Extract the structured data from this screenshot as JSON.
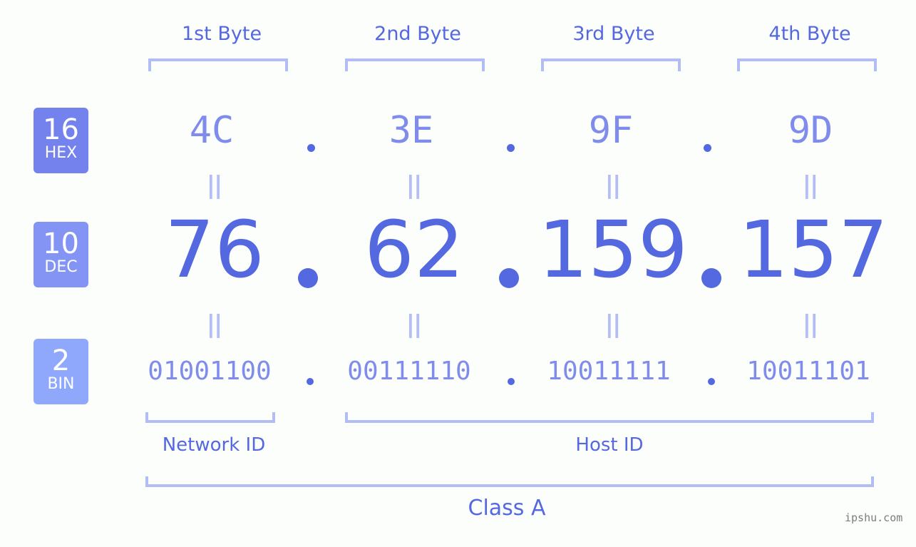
{
  "bytes": [
    {
      "label": "1st Byte",
      "hex": "4C",
      "dec": "76",
      "bin": "01001100"
    },
    {
      "label": "2nd Byte",
      "hex": "3E",
      "dec": "62",
      "bin": "00111110"
    },
    {
      "label": "3rd Byte",
      "hex": "9F",
      "dec": "159",
      "bin": "10011111"
    },
    {
      "label": "4th Byte",
      "hex": "9D",
      "dec": "157",
      "bin": "10011101"
    }
  ],
  "badges": {
    "hex": {
      "num": "16",
      "label": "HEX",
      "color": "#7382ec"
    },
    "dec": {
      "num": "10",
      "label": "DEC",
      "color": "#8494f4"
    },
    "bin": {
      "num": "2",
      "label": "BIN",
      "color": "#8fa8fb"
    }
  },
  "equals_glyph": "||",
  "network_id_label": "Network ID",
  "host_id_label": "Host ID",
  "class_label": "Class A",
  "watermark": "ipshu.com",
  "colors": {
    "accent": "#5468e0",
    "light": "#7f8cec",
    "bracket": "#b2bdf6"
  }
}
